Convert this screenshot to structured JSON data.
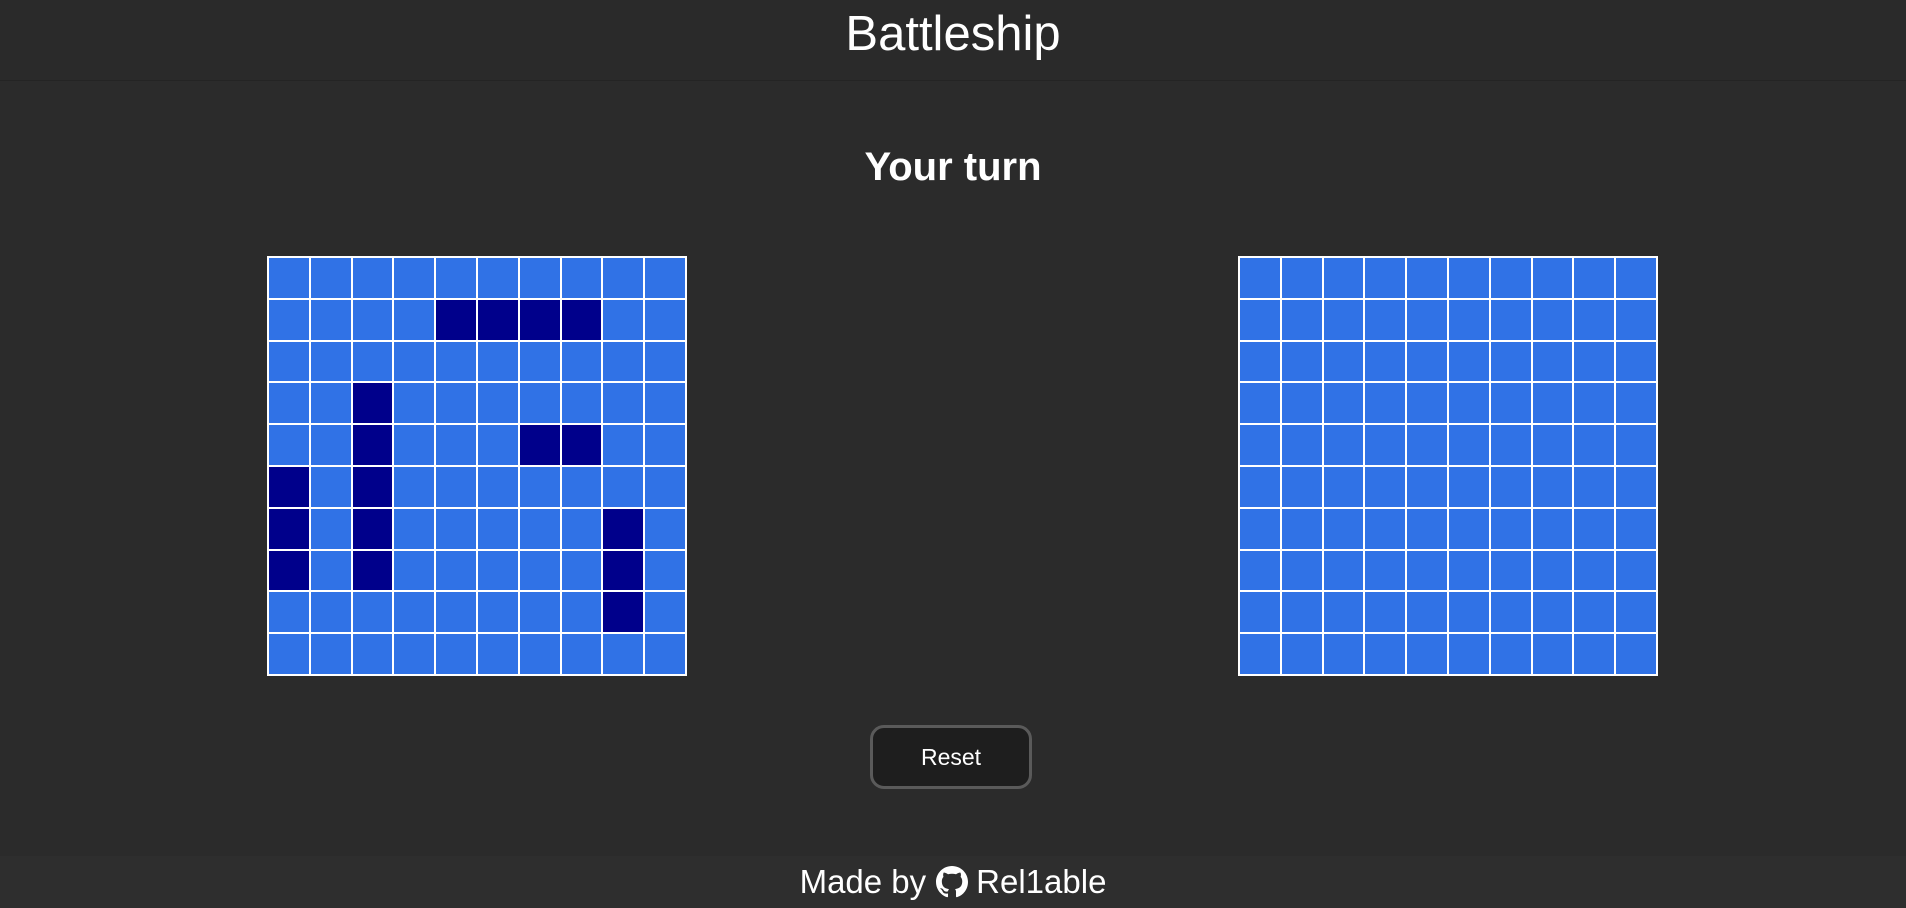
{
  "app": {
    "title": "Battleship"
  },
  "status": {
    "text": "Your turn"
  },
  "boards": {
    "player": {
      "size": 10,
      "ships": [
        [
          1,
          4
        ],
        [
          1,
          5
        ],
        [
          1,
          6
        ],
        [
          1,
          7
        ],
        [
          3,
          2
        ],
        [
          4,
          2
        ],
        [
          5,
          2
        ],
        [
          6,
          2
        ],
        [
          7,
          2
        ],
        [
          4,
          6
        ],
        [
          4,
          7
        ],
        [
          5,
          0
        ],
        [
          6,
          0
        ],
        [
          7,
          0
        ],
        [
          6,
          8
        ],
        [
          7,
          8
        ],
        [
          8,
          8
        ]
      ]
    },
    "enemy": {
      "size": 10,
      "ships": []
    }
  },
  "colors": {
    "water": "#3072e6",
    "ship": "#00008b",
    "grid": "#ffffff",
    "background": "#2b2b2b"
  },
  "controls": {
    "reset_label": "Reset"
  },
  "footer": {
    "made_by": "Made by",
    "author": "Rel1able",
    "icon": "github-icon"
  }
}
